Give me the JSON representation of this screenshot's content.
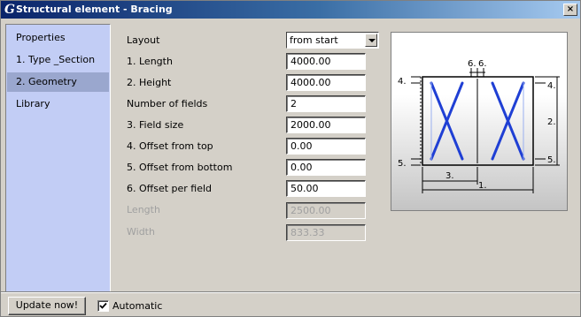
{
  "window": {
    "title": "Structural element - Bracing",
    "close_label": "×",
    "logo": "G"
  },
  "sidebar": {
    "items": [
      {
        "label": "Properties",
        "active": false
      },
      {
        "label": "1. Type _Section",
        "active": false
      },
      {
        "label": "2. Geometry",
        "active": true
      },
      {
        "label": "Library",
        "active": false
      }
    ]
  },
  "form": {
    "layout": {
      "label": "Layout",
      "value": "from start"
    },
    "length": {
      "label": "1. Length",
      "value": "4000.00"
    },
    "height": {
      "label": "2. Height",
      "value": "4000.00"
    },
    "num_fields": {
      "label": "Number of fields",
      "value": "2"
    },
    "field_size": {
      "label": "3. Field size",
      "value": "2000.00"
    },
    "offset_top": {
      "label": "4. Offset from top",
      "value": "0.00"
    },
    "offset_bottom": {
      "label": "5. Offset from bottom",
      "value": "0.00"
    },
    "offset_field": {
      "label": "6. Offset per field",
      "value": "50.00"
    },
    "result_length": {
      "label": "Length",
      "value": "2500.00"
    },
    "result_width": {
      "label": "Width",
      "value": "833.33"
    }
  },
  "diagram": {
    "labels": {
      "d1": "1.",
      "d2": "2.",
      "d3": "3.",
      "d4": "4.",
      "d5": "5.",
      "d6": "6."
    }
  },
  "footer": {
    "update_label": "Update now!",
    "automatic_label": "Automatic",
    "automatic_checked": true
  },
  "colors": {
    "titlebar_start": "#0a246a",
    "titlebar_end": "#a6caf0",
    "sidebar_bg": "#c2cdf5",
    "sidebar_active": "#9aa7ce",
    "brace_blue": "#1f3fd4"
  }
}
